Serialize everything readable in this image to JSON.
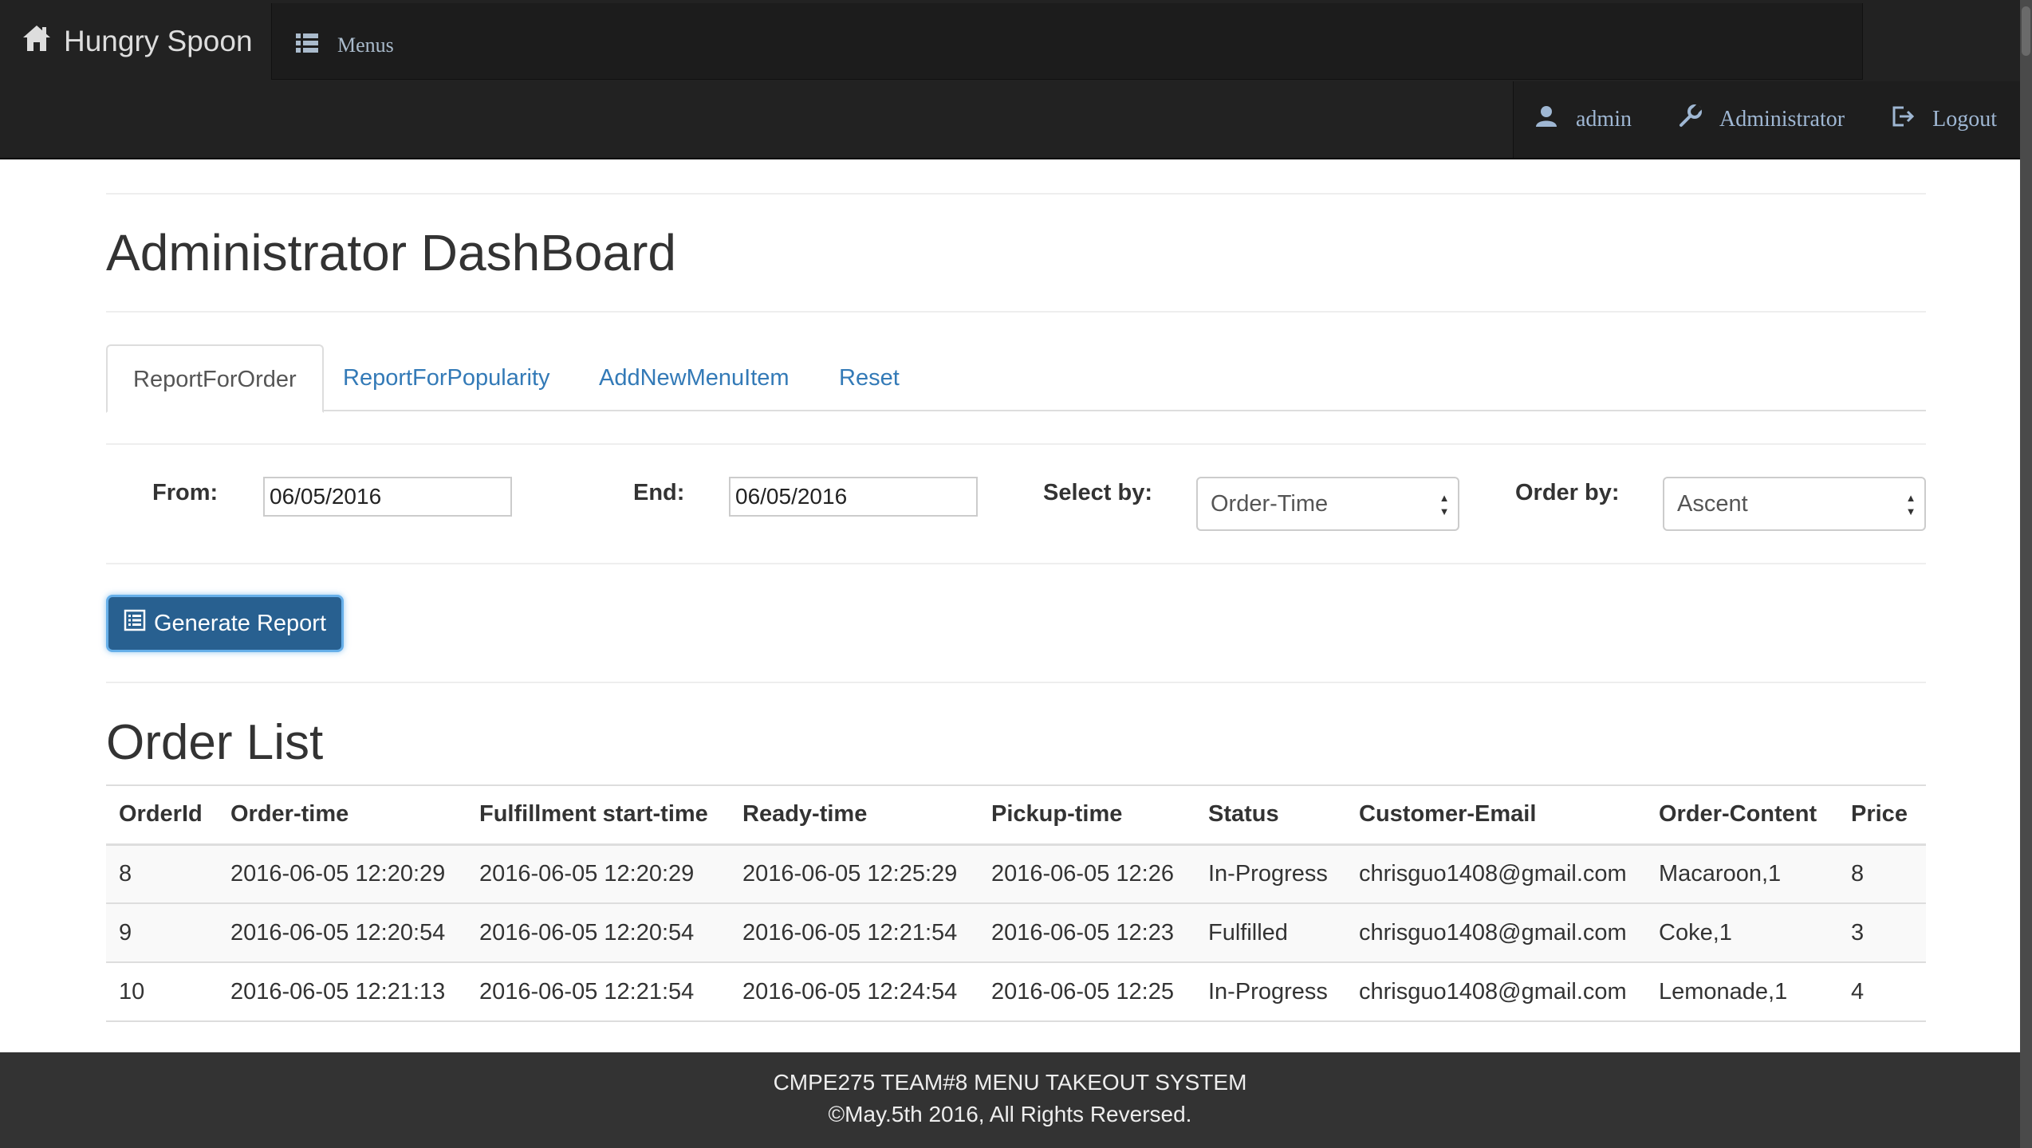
{
  "navbar": {
    "brand": "Hungry Spoon",
    "menus_label": "Menus",
    "user": "admin",
    "role": "Administrator",
    "logout": "Logout"
  },
  "page": {
    "title": "Administrator DashBoard"
  },
  "tabs": [
    {
      "label": "ReportForOrder",
      "active": true
    },
    {
      "label": "ReportForPopularity",
      "active": false
    },
    {
      "label": "AddNewMenuItem",
      "active": false
    },
    {
      "label": "Reset",
      "active": false
    }
  ],
  "filters": {
    "from_label": "From:",
    "from_value": "06/05/2016",
    "end_label": "End:",
    "end_value": "06/05/2016",
    "select_by_label": "Select by:",
    "select_by_value": "Order-Time",
    "order_by_label": "Order by:",
    "order_by_value": "Ascent"
  },
  "generate_button": "Generate Report",
  "order_list": {
    "title": "Order List",
    "columns": [
      "OrderId",
      "Order-time",
      "Fulfillment start-time",
      "Ready-time",
      "Pickup-time",
      "Status",
      "Customer-Email",
      "Order-Content",
      "Price"
    ],
    "rows": [
      [
        "8",
        "2016-06-05 12:20:29",
        "2016-06-05 12:20:29",
        "2016-06-05 12:25:29",
        "2016-06-05 12:26",
        "In-Progress",
        "chrisguo1408@gmail.com",
        "Macaroon,1",
        "8"
      ],
      [
        "9",
        "2016-06-05 12:20:54",
        "2016-06-05 12:20:54",
        "2016-06-05 12:21:54",
        "2016-06-05 12:23",
        "Fulfilled",
        "chrisguo1408@gmail.com",
        "Coke,1",
        "3"
      ],
      [
        "10",
        "2016-06-05 12:21:13",
        "2016-06-05 12:21:54",
        "2016-06-05 12:24:54",
        "2016-06-05 12:25",
        "In-Progress",
        "chrisguo1408@gmail.com",
        "Lemonade,1",
        "4"
      ]
    ]
  },
  "footer": {
    "line1": "CMPE275 TEAM#8 MENU TAKEOUT SYSTEM",
    "line2": "©May.5th 2016, All Rights Reversed."
  },
  "colors": {
    "navbar_bg": "#222222",
    "link": "#337ab7",
    "button_primary": "#286090",
    "footer_bg": "#333333"
  }
}
